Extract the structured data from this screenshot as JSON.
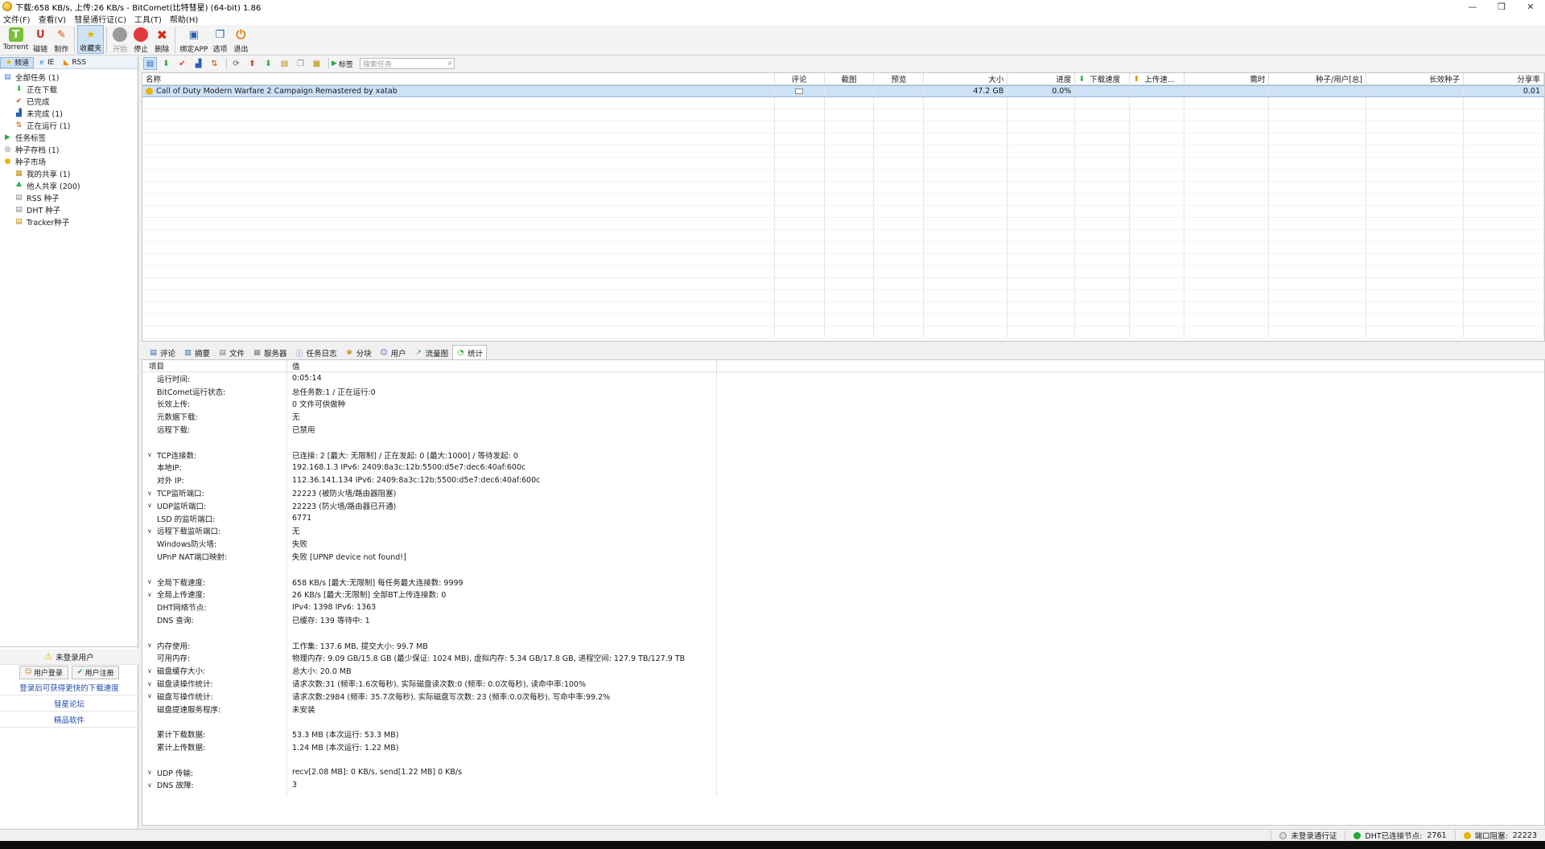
{
  "window": {
    "title": "下载:658 KB/s, 上传:26 KB/s - BitComet(比特彗星) (64-bit) 1.86"
  },
  "menu": [
    "文件(F)",
    "查看(V)",
    "彗星通行证(C)",
    "工具(T)",
    "帮助(H)"
  ],
  "toolbar": {
    "torrent": "Torrent",
    "magnet": "磁链",
    "make": "制作",
    "favorites": "收藏夹",
    "start": "开始",
    "stop": "停止",
    "delete": "删除",
    "bind_app": "绑定APP",
    "options": "选项",
    "exit": "退出"
  },
  "left_tabs": [
    "频道",
    "IE",
    "RSS"
  ],
  "tree": [
    {
      "label": "全部任务 (1)",
      "level": 0,
      "icon": "all-tasks-icon"
    },
    {
      "label": "正在下载",
      "level": 1,
      "icon": "download-arrow-icon"
    },
    {
      "label": "已完成",
      "level": 1,
      "icon": "check-icon"
    },
    {
      "label": "未完成 (1)",
      "level": 1,
      "icon": "incomplete-icon"
    },
    {
      "label": "正在运行 (1)",
      "level": 1,
      "icon": "running-icon"
    },
    {
      "label": "任务标签",
      "level": 0,
      "icon": "tag-icon"
    },
    {
      "label": "种子存档 (1)",
      "level": 0,
      "icon": "archive-icon"
    },
    {
      "label": "种子市场",
      "level": 0,
      "icon": "market-icon"
    },
    {
      "label": "我的共享 (1)",
      "level": 1,
      "icon": "my-share-icon"
    },
    {
      "label": "他人共享 (200)",
      "level": 1,
      "icon": "others-share-icon"
    },
    {
      "label": "RSS 种子",
      "level": 1,
      "icon": "rss-seed-icon"
    },
    {
      "label": "DHT 种子",
      "level": 1,
      "icon": "dht-seed-icon"
    },
    {
      "label": "Tracker种子",
      "level": 1,
      "icon": "tracker-seed-icon"
    }
  ],
  "login_panel": {
    "warning": "未登录用户",
    "login": "用户登录",
    "register": "用户注册",
    "link1": "登录后可获得更快的下载速度",
    "link2": "彗星论坛",
    "link3": "精品软件"
  },
  "task_toolbar": {
    "tag_label": "标签",
    "search_placeholder": "搜索任务"
  },
  "task_columns": [
    "名称",
    "评论",
    "截图",
    "预览",
    "大小",
    "进度",
    "下载速度",
    "上传速...",
    "需时",
    "种子/用户[总]",
    "长效种子",
    "分享率"
  ],
  "tasks": [
    {
      "name": "Call of Duty Modern Warfare 2 Campaign Remastered by xatab",
      "size": "47.2 GB",
      "progress": "0.0%",
      "ratio": "0.01"
    }
  ],
  "detail_tabs": [
    "评论",
    "摘要",
    "文件",
    "服务器",
    "任务日志",
    "分块",
    "用户",
    "流量图",
    "统计"
  ],
  "stats_header": {
    "key": "项目",
    "value": "值"
  },
  "stats": [
    {
      "k": "运行时间:",
      "v": "0:05:14",
      "arrow": false
    },
    {
      "k": "BitComet运行状态:",
      "v": "总任务数:1 / 正在运行:0",
      "arrow": false
    },
    {
      "k": "长效上传:",
      "v": "0 文件可供做种",
      "arrow": false
    },
    {
      "k": "元数据下载:",
      "v": "无",
      "arrow": false
    },
    {
      "k": "远程下载:",
      "v": "已禁用",
      "arrow": false
    },
    {
      "k": "",
      "v": "",
      "arrow": false
    },
    {
      "k": "TCP连接数:",
      "v": "已连接: 2 [最大: 无限制] / 正在发起: 0 [最大:1000] / 等待发起: 0",
      "arrow": true
    },
    {
      "k": "本地IP:",
      "v": "192.168.1.3    IPv6: 2409:8a3c:12b:5500:d5e7:dec6:40af:600c",
      "arrow": false
    },
    {
      "k": "对外 IP:",
      "v": "112.36.141.134    IPv6: 2409:8a3c:12b:5500:d5e7:dec6:40af:600c",
      "arrow": false
    },
    {
      "k": "TCP监听端口:",
      "v": "22223 (被防火墙/路由器阻塞)",
      "arrow": true
    },
    {
      "k": "UDP监听端口:",
      "v": "22223 (防火墙/路由器已开通)",
      "arrow": true
    },
    {
      "k": "LSD 的监听端口:",
      "v": "6771",
      "arrow": false
    },
    {
      "k": "远程下载监听端口:",
      "v": "无",
      "arrow": true
    },
    {
      "k": "Windows防火墙:",
      "v": "失败",
      "arrow": false
    },
    {
      "k": "UPnP NAT端口映射:",
      "v": "失败 [UPNP device not found!]",
      "arrow": false
    },
    {
      "k": "",
      "v": "",
      "arrow": false
    },
    {
      "k": "全局下载速度:",
      "v": "658 KB/s [最大:无限制]      每任务最大连接数: 9999",
      "arrow": true
    },
    {
      "k": "全局上传速度:",
      "v": "26 KB/s [最大:无限制]      全部BT上传连接数: 0",
      "arrow": true
    },
    {
      "k": "DHT网络节点:",
      "v": "IPv4: 1398  IPv6: 1363",
      "arrow": false
    },
    {
      "k": "DNS 查询:",
      "v": "已缓存:  139   等待中:  1",
      "arrow": false
    },
    {
      "k": "",
      "v": "",
      "arrow": false
    },
    {
      "k": "内存使用:",
      "v": "工作集: 137.6 MB, 提交大小: 99.7 MB",
      "arrow": true
    },
    {
      "k": "可用内存:",
      "v": "物理内存: 9.09 GB/15.8 GB (最少保证: 1024 MB), 虚拟内存: 5.34 GB/17.8 GB, 进程空间: 127.9 TB/127.9 TB",
      "arrow": false
    },
    {
      "k": "磁盘缓存大小:",
      "v": "总大小:  20.0 MB",
      "arrow": true
    },
    {
      "k": "磁盘读操作统计:",
      "v": "请求次数:31 (频率:1.6次每秒), 实际磁盘读次数:0 (频率: 0.0次每秒), 读命中率:100%",
      "arrow": true
    },
    {
      "k": "磁盘写操作统计:",
      "v": "请求次数:2984 (频率: 35.7次每秒), 实际磁盘写次数: 23 (频率:0.0次每秒), 写命中率:99.2%",
      "arrow": true
    },
    {
      "k": "磁盘提速服务程序:",
      "v": "未安装",
      "arrow": false
    },
    {
      "k": "",
      "v": "",
      "arrow": false
    },
    {
      "k": "累计下载数据:",
      "v": "53.3 MB (本次运行: 53.3 MB)",
      "arrow": false
    },
    {
      "k": "累计上传数据:",
      "v": "1.24 MB (本次运行: 1.22 MB)",
      "arrow": false
    },
    {
      "k": "",
      "v": "",
      "arrow": false
    },
    {
      "k": "UDP 传输:",
      "v": "recv[2.08 MB]: 0 KB/s, send[1.22 MB] 0 KB/s",
      "arrow": true
    },
    {
      "k": "DNS 故障:",
      "v": "3",
      "arrow": true
    }
  ],
  "statusbar": {
    "passport": "未登录通行证",
    "dht": "DHT已连接节点:",
    "dht_count": "2761",
    "port": "端口阻塞:",
    "port_value": "22223"
  },
  "colors": {
    "selection": "#cde1f7",
    "link": "#1f4aa8",
    "dht_dot": "#22a83a",
    "port_dot": "#e3b400"
  }
}
